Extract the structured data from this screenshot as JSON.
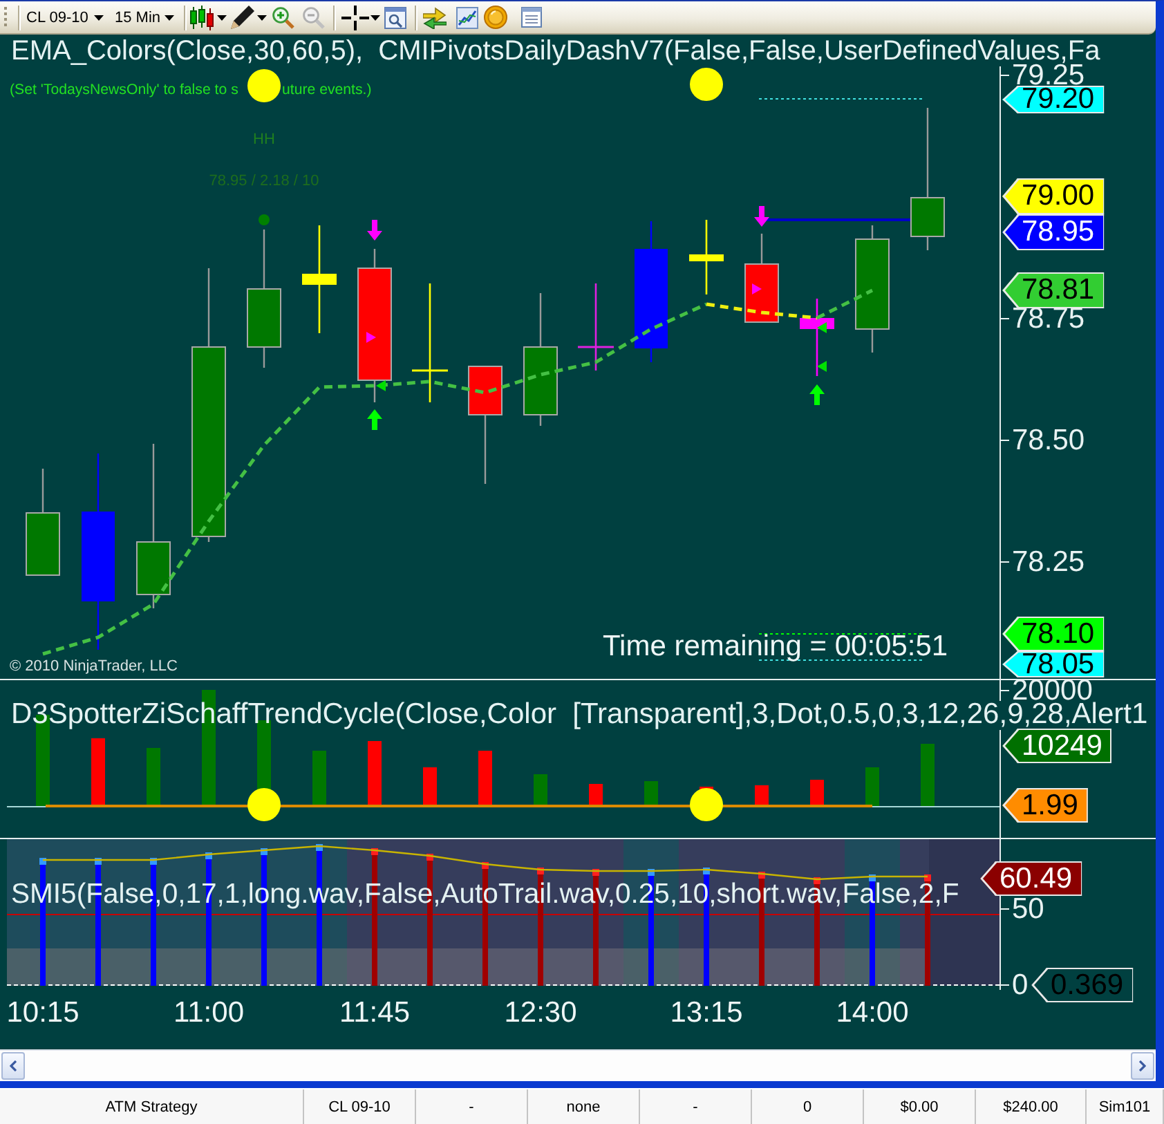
{
  "toolbar": {
    "instrument": "CL 09-10",
    "interval": "15 Min"
  },
  "price_panel": {
    "title": "EMA_Colors(Close,30,60,5),  CMIPivotsDailyDashV7(False,False,UserDefinedValues,Fa",
    "news_note": [
      "(Set 'TodaysNewsOnly' to false to s",
      "uture events.)"
    ],
    "swing_label": "HH",
    "swing_values": "78.95 / 2.18 / 10",
    "axis_labels": [
      "79.25",
      "78.75",
      "78.50",
      "78.25"
    ],
    "price_markers": [
      {
        "text": "79.20",
        "kind": "filled",
        "color": "#00ffff"
      },
      {
        "text": "79.00",
        "kind": "filled",
        "color": "#ffff00"
      },
      {
        "text": "78.95",
        "kind": "filled",
        "color": "#0000ff"
      },
      {
        "text": "78.81",
        "kind": "filled",
        "color": "#32cd32"
      },
      {
        "text": "78.10",
        "kind": "filled",
        "color": "#00ff00"
      },
      {
        "text": "78.05",
        "kind": "filled",
        "color": "#00ffff"
      }
    ],
    "time_remaining": "Time remaining = 00:05:51",
    "copyright": "© 2010 NinjaTrader, LLC"
  },
  "indicator_panels": [
    {
      "title": "D3SpotterZiSchaffTrendCycle(Close,Color  [Transparent],3,Dot,0.5,0,3,12,26,9,28,Alert1",
      "axis_labels": [
        "20000"
      ],
      "price_markers": [
        {
          "text": "10249",
          "kind": "filled",
          "color": "#007000"
        },
        {
          "text": "1.99",
          "kind": "filled",
          "color": "#ff8c00"
        }
      ]
    },
    {
      "title": "SMI5(False,0,17,1,long.wav,False,AutoTrail.wav,0.25,10,short.wav,False,2,F",
      "axis_labels": [
        "50",
        "0"
      ],
      "price_markers": [
        {
          "text": "60.49",
          "kind": "filled",
          "color": "#8b0000"
        },
        {
          "text": "0.369",
          "kind": "outline"
        }
      ]
    }
  ],
  "time_axis": {
    "labels": [
      "10:15",
      "11:00",
      "11:45",
      "12:30",
      "13:15",
      "14:00"
    ]
  },
  "status_bar": {
    "cells": [
      "ATM Strategy",
      "CL 09-10",
      "-",
      "none",
      "-",
      "0",
      "$0.00",
      "$240.00",
      "Sim101"
    ]
  }
}
